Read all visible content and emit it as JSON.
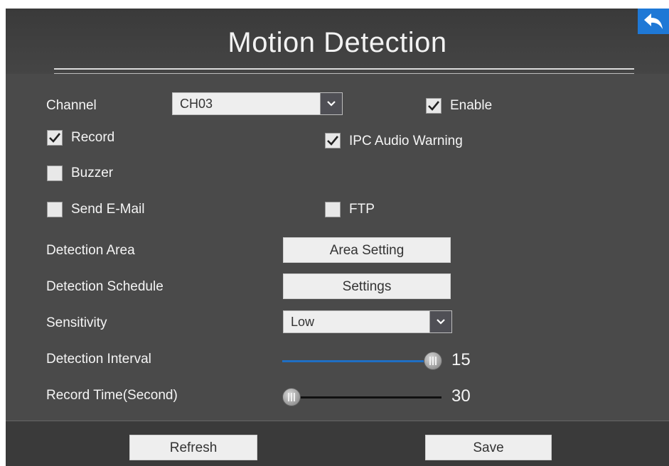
{
  "header": {
    "title": "Motion Detection"
  },
  "form": {
    "channel": {
      "label": "Channel",
      "value": "CH03"
    },
    "enable": {
      "label": "Enable",
      "checked": true
    },
    "record": {
      "label": "Record",
      "checked": true
    },
    "ipc_audio_warning": {
      "label": "IPC Audio Warning",
      "checked": true
    },
    "buzzer": {
      "label": "Buzzer",
      "checked": false
    },
    "send_email": {
      "label": "Send E-Mail",
      "checked": false
    },
    "ftp": {
      "label": "FTP",
      "checked": false
    },
    "detection_area": {
      "label": "Detection Area",
      "button": "Area Setting"
    },
    "detection_schedule": {
      "label": "Detection Schedule",
      "button": "Settings"
    },
    "sensitivity": {
      "label": "Sensitivity",
      "value": "Low"
    },
    "detection_interval": {
      "label": "Detection Interval",
      "value": "15",
      "level": 1.0
    },
    "record_time": {
      "label": "Record Time(Second)",
      "value": "30",
      "level": 0.0
    }
  },
  "footer": {
    "refresh_label": "Refresh",
    "save_label": "Save"
  },
  "colors": {
    "accent_blue": "#1e78d6",
    "panel_bg": "#4a4a4a",
    "slider_fill": "#1f6fc4"
  },
  "icons": {
    "back": "back-arrow-icon",
    "dropdown": "chevron-down-icon",
    "check": "checkmark-icon"
  }
}
